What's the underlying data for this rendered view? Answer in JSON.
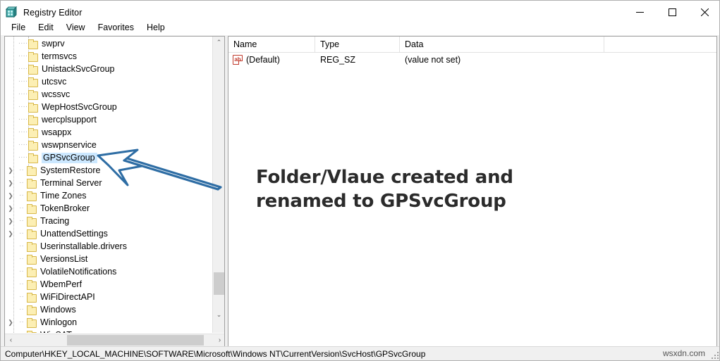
{
  "window": {
    "title": "Registry Editor",
    "icon": "registry-editor-icon",
    "controls": {
      "minimize": "—",
      "maximize": "☐",
      "close": "✕"
    }
  },
  "menubar": {
    "items": [
      "File",
      "Edit",
      "View",
      "Favorites",
      "Help"
    ]
  },
  "tree": {
    "items": [
      {
        "label": "swprv",
        "indent": 2,
        "expandable": false,
        "selected": false
      },
      {
        "label": "termsvcs",
        "indent": 2,
        "expandable": false,
        "selected": false
      },
      {
        "label": "UnistackSvcGroup",
        "indent": 2,
        "expandable": false,
        "selected": false
      },
      {
        "label": "utcsvc",
        "indent": 2,
        "expandable": false,
        "selected": false
      },
      {
        "label": "wcssvc",
        "indent": 2,
        "expandable": false,
        "selected": false
      },
      {
        "label": "WepHostSvcGroup",
        "indent": 2,
        "expandable": false,
        "selected": false
      },
      {
        "label": "wercplsupport",
        "indent": 2,
        "expandable": false,
        "selected": false
      },
      {
        "label": "wsappx",
        "indent": 2,
        "expandable": false,
        "selected": false
      },
      {
        "label": "wswpnservice",
        "indent": 2,
        "expandable": false,
        "selected": false
      },
      {
        "label": "GPSvcGroup",
        "indent": 2,
        "expandable": false,
        "selected": true
      },
      {
        "label": "SystemRestore",
        "indent": 1,
        "expandable": true,
        "selected": false
      },
      {
        "label": "Terminal Server",
        "indent": 1,
        "expandable": true,
        "selected": false
      },
      {
        "label": "Time Zones",
        "indent": 1,
        "expandable": true,
        "selected": false
      },
      {
        "label": "TokenBroker",
        "indent": 1,
        "expandable": true,
        "selected": false
      },
      {
        "label": "Tracing",
        "indent": 1,
        "expandable": true,
        "selected": false
      },
      {
        "label": "UnattendSettings",
        "indent": 1,
        "expandable": true,
        "selected": false
      },
      {
        "label": "Userinstallable.drivers",
        "indent": 1,
        "expandable": false,
        "selected": false
      },
      {
        "label": "VersionsList",
        "indent": 1,
        "expandable": false,
        "selected": false
      },
      {
        "label": "VolatileNotifications",
        "indent": 1,
        "expandable": false,
        "selected": false
      },
      {
        "label": "WbemPerf",
        "indent": 1,
        "expandable": false,
        "selected": false
      },
      {
        "label": "WiFiDirectAPI",
        "indent": 1,
        "expandable": false,
        "selected": false
      },
      {
        "label": "Windows",
        "indent": 1,
        "expandable": false,
        "selected": false
      },
      {
        "label": "Winlogon",
        "indent": 1,
        "expandable": true,
        "selected": false
      },
      {
        "label": "WinSAT",
        "indent": 1,
        "expandable": false,
        "selected": false
      }
    ],
    "scroll": {
      "up_arrow": "⌃",
      "down_arrow": "⌄",
      "left_arrow": "‹",
      "right_arrow": "›"
    }
  },
  "values": {
    "columns": [
      "Name",
      "Type",
      "Data"
    ],
    "rows": [
      {
        "icon": "string-value-icon",
        "name": "(Default)",
        "type": "REG_SZ",
        "data": "(value not set)"
      }
    ]
  },
  "annotation": {
    "line1": "Folder/Vlaue created and",
    "line2": "renamed to GPSvcGroup",
    "arrow_color": "#2e6da4"
  },
  "statusbar": {
    "path": "Computer\\HKEY_LOCAL_MACHINE\\SOFTWARE\\Microsoft\\Windows NT\\CurrentVersion\\SvcHost\\GPSvcGroup",
    "watermark": "wsxdn.com"
  }
}
